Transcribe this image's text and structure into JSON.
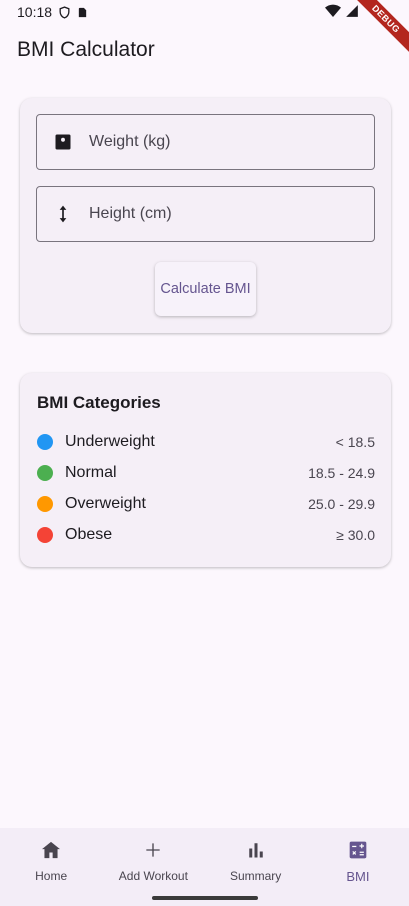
{
  "status_bar": {
    "time": "10:18",
    "debug_label": "DEBUG"
  },
  "app": {
    "title": "BMI Calculator"
  },
  "form": {
    "weight_placeholder": "Weight (kg)",
    "height_placeholder": "Height (cm)",
    "calculate_label": "Calculate BMI"
  },
  "categories": {
    "title": "BMI Categories",
    "items": [
      {
        "name": "Underweight",
        "range": "< 18.5",
        "color": "#2196f3"
      },
      {
        "name": "Normal",
        "range": "18.5 - 24.9",
        "color": "#4caf50"
      },
      {
        "name": "Overweight",
        "range": "25.0 - 29.9",
        "color": "#ff9800"
      },
      {
        "name": "Obese",
        "range": "≥ 30.0",
        "color": "#f44336"
      }
    ]
  },
  "nav": {
    "items": [
      {
        "label": "Home",
        "icon": "home-icon"
      },
      {
        "label": "Add Workout",
        "icon": "plus-icon"
      },
      {
        "label": "Summary",
        "icon": "bar-chart-icon"
      },
      {
        "label": "BMI",
        "icon": "calculator-icon",
        "active": true
      }
    ]
  },
  "colors": {
    "accent": "#65558f",
    "background": "#fcf7fd"
  }
}
